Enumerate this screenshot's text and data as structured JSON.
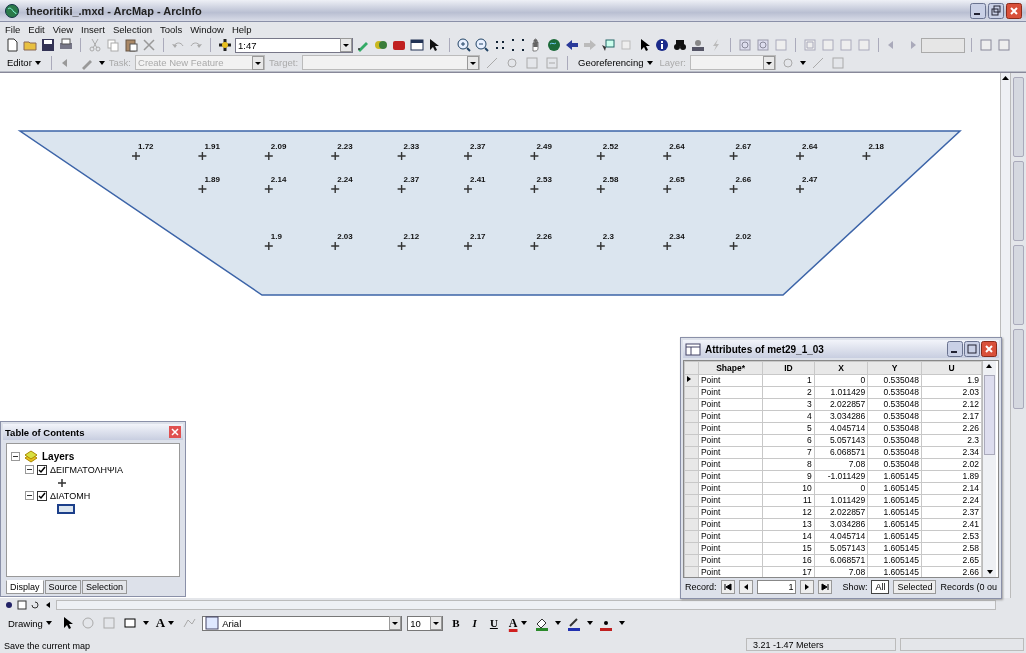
{
  "window": {
    "title": "theoritiki_.mxd - ArcMap - ArcInfo"
  },
  "menu": [
    "File",
    "Edit",
    "View",
    "Insert",
    "Selection",
    "Tools",
    "Window",
    "Help"
  ],
  "standard_toolbar": {
    "scale": "1:47"
  },
  "editor_toolbar": [
    {
      "kind": "menu",
      "label": "Editor",
      "disabled": false
    },
    {
      "kind": "label",
      "label": "Task:",
      "disabled": true
    },
    {
      "kind": "combo",
      "value": "Create New Feature",
      "disabled": true
    },
    {
      "kind": "label",
      "label": "Target:",
      "disabled": true
    },
    {
      "kind": "combo",
      "disabled": true
    },
    {
      "kind": "menu",
      "label": "Georeferencing",
      "disabled": false
    },
    {
      "kind": "label",
      "label": "Layer:",
      "disabled": true
    },
    {
      "kind": "combo",
      "disabled": true
    }
  ],
  "map": {
    "point_rows": [
      [
        "1.72",
        "1.91",
        "2.09",
        "2.23",
        "2.33",
        "2.37",
        "2.49",
        "2.52",
        "2.64",
        "2.67",
        "2.64",
        "2.18"
      ],
      [
        null,
        "1.89",
        "2.14",
        "2.24",
        "2.37",
        "2.41",
        "2.53",
        "2.58",
        "2.65",
        "2.66",
        "2.47"
      ],
      [
        null,
        null,
        "1.9",
        "2.03",
        "2.12",
        "2.17",
        "2.26",
        "2.3",
        "2.34",
        "2.02"
      ]
    ]
  },
  "attributes_window": {
    "title": "Attributes of met29_1_03",
    "columns": [
      "Shape*",
      "ID",
      "X",
      "Y",
      "U"
    ],
    "rows": [
      {
        "current": true,
        "cells": [
          "Point",
          "1",
          "0",
          "0.535048",
          "1.9"
        ]
      },
      {
        "current": false,
        "cells": [
          "Point",
          "2",
          "1.011429",
          "0.535048",
          "2.03"
        ]
      },
      {
        "current": false,
        "cells": [
          "Point",
          "3",
          "2.022857",
          "0.535048",
          "2.12"
        ]
      },
      {
        "current": false,
        "cells": [
          "Point",
          "4",
          "3.034286",
          "0.535048",
          "2.17"
        ]
      },
      {
        "current": false,
        "cells": [
          "Point",
          "5",
          "4.045714",
          "0.535048",
          "2.26"
        ]
      },
      {
        "current": false,
        "cells": [
          "Point",
          "6",
          "5.057143",
          "0.535048",
          "2.3"
        ]
      },
      {
        "current": false,
        "cells": [
          "Point",
          "7",
          "6.068571",
          "0.535048",
          "2.34"
        ]
      },
      {
        "current": false,
        "cells": [
          "Point",
          "8",
          "7.08",
          "0.535048",
          "2.02"
        ]
      },
      {
        "current": false,
        "cells": [
          "Point",
          "9",
          "-1.011429",
          "1.605145",
          "1.89"
        ]
      },
      {
        "current": false,
        "cells": [
          "Point",
          "10",
          "0",
          "1.605145",
          "2.14"
        ]
      },
      {
        "current": false,
        "cells": [
          "Point",
          "11",
          "1.011429",
          "1.605145",
          "2.24"
        ]
      },
      {
        "current": false,
        "cells": [
          "Point",
          "12",
          "2.022857",
          "1.605145",
          "2.37"
        ]
      },
      {
        "current": false,
        "cells": [
          "Point",
          "13",
          "3.034286",
          "1.605145",
          "2.41"
        ]
      },
      {
        "current": false,
        "cells": [
          "Point",
          "14",
          "4.045714",
          "1.605145",
          "2.53"
        ]
      },
      {
        "current": false,
        "cells": [
          "Point",
          "15",
          "5.057143",
          "1.605145",
          "2.58"
        ]
      },
      {
        "current": false,
        "cells": [
          "Point",
          "16",
          "6.068571",
          "1.605145",
          "2.65"
        ]
      },
      {
        "current": false,
        "cells": [
          "Point",
          "17",
          "7.08",
          "1.605145",
          "2.66"
        ]
      }
    ],
    "footer": {
      "record_label": "Record:",
      "record": "1",
      "show_label": "Show:",
      "show_options": [
        {
          "label": "All",
          "selected": true
        },
        {
          "label": "Selected",
          "selected": false
        }
      ],
      "records": "Records (0 ou"
    }
  },
  "table_of_contents": {
    "title": "Table of Contents",
    "root": {
      "label": "Layers",
      "expanded": true,
      "children": [
        {
          "label": "ΔΕΙΓΜΑΤΟΛΗΨΙΑ",
          "kind": "point",
          "checked": true,
          "expanded": true
        },
        {
          "label": "ΔΙΑΤΟΜΗ",
          "kind": "polygon",
          "checked": true,
          "expanded": true
        }
      ]
    },
    "tabs": [
      {
        "label": "Display",
        "selected": true
      },
      {
        "label": "Source",
        "selected": false
      },
      {
        "label": "Selection",
        "selected": false
      }
    ]
  },
  "drawing_toolbar": {
    "menu": "Drawing",
    "text_tool": "A",
    "font": "Arial",
    "size": "10",
    "styles": [
      "B",
      "I",
      "U"
    ],
    "font_color": "A"
  },
  "status_bar": {
    "message": "Save the current map",
    "coordinates": "3.21  -1.47 Meters"
  }
}
